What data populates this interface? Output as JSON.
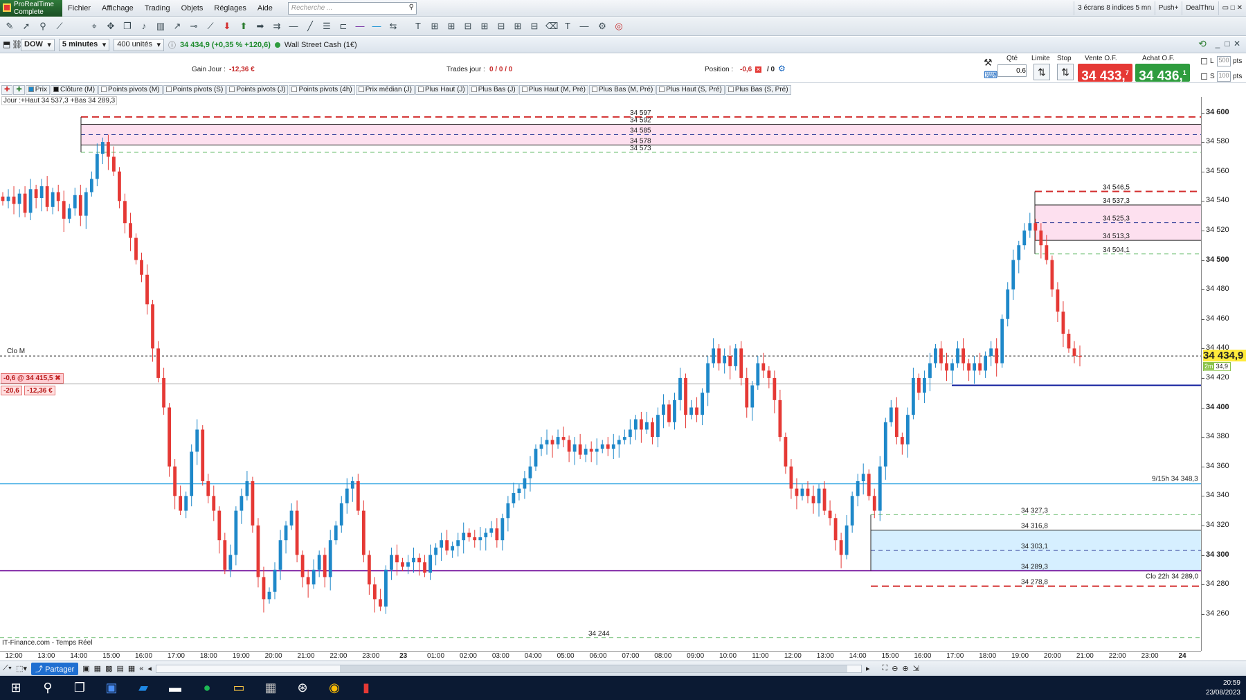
{
  "app": {
    "logo_line1": "ProRealTime",
    "logo_line2": "Complete"
  },
  "menu": [
    "Fichier",
    "Affichage",
    "Trading",
    "Objets",
    "Réglages",
    "Aide"
  ],
  "search": {
    "placeholder": "Recherche ..."
  },
  "top_right": {
    "layout": "3 écrans 8 indices 5 mn",
    "push": "Push+",
    "dealthru": "DealThru"
  },
  "instrument": {
    "symbol": "DOW",
    "period": "5 minutes",
    "units": "400 unités",
    "price": "34 434,9 (+0,35 % +120,6)",
    "name": "Wall Street Cash (1€)"
  },
  "trade": {
    "gain_label": "Gain Jour :",
    "gain_value": "-12,36 €",
    "trades_label": "Trades jour :",
    "trades_value": "0 / 0 / 0",
    "position_label": "Position :",
    "position_value": "-0,6",
    "position_extra": "/ 0",
    "qty_label": "Qté",
    "qty_value": "0.6",
    "limit_label": "Limite",
    "stop_label": "Stop",
    "sell_label": "Vente O.F.",
    "buy_label": "Achat O.F.",
    "sell_price": "34 433,",
    "sell_sup": "7",
    "buy_price": "34 436,",
    "buy_sup": "1",
    "l_label": "L",
    "s_label": "S",
    "l_pts": "500",
    "s_pts": "100",
    "pts": "pts"
  },
  "legend": [
    {
      "label": "Prix",
      "checked": true,
      "color": "#e53935"
    },
    {
      "label": "Clôture (M)",
      "checked": true,
      "color": "#111"
    },
    {
      "label": "Points pivots (M)",
      "checked": false
    },
    {
      "label": "Points pivots (S)",
      "checked": false
    },
    {
      "label": "Points pivots (J)",
      "checked": false
    },
    {
      "label": "Points pivots (4h)",
      "checked": false
    },
    {
      "label": "Prix médian (J)",
      "checked": false
    },
    {
      "label": "Plus Haut (J)",
      "checked": false
    },
    {
      "label": "Plus Bas (J)",
      "checked": false
    },
    {
      "label": "Plus Haut (M, Pré)",
      "checked": false
    },
    {
      "label": "Plus Bas (M, Pré)",
      "checked": false
    },
    {
      "label": "Plus Haut (S, Pré)",
      "checked": false
    },
    {
      "label": "Plus Bas (S, Pré)",
      "checked": false
    }
  ],
  "jour_info": "Jour :+Haut 34 537,3 +Bas 34 289,3",
  "position_box": {
    "line1": "-0,6 @ 34 415,5",
    "line2a": "-20,6",
    "line2b": "-12,36 €"
  },
  "clo_m_label": "Clo M",
  "footer_source": "IT-Finance.com - Temps Réel",
  "bottom": {
    "share": "Partager"
  },
  "clock": {
    "time": "20:59",
    "date": "23/08/2023"
  },
  "colors": {
    "up": "#1e88c9",
    "down": "#e53935",
    "pink_zone": "#fde0ef",
    "blue_zone": "#d6efff",
    "purple": "#7b1fa2",
    "cyan": "#4fb3e6",
    "navy": "#0d1a9c",
    "current_price_bg": "#ffeb3b"
  },
  "chart_data": {
    "type": "candlestick",
    "ylim": [
      34240,
      34610
    ],
    "y_ticks": [
      "34 600",
      "34 580",
      "34 560",
      "34 540",
      "34 520",
      "34 500",
      "34 480",
      "34 460",
      "34 440",
      "34 420",
      "34 400",
      "34 380",
      "34 360",
      "34 340",
      "34 320",
      "34 300",
      "34 280",
      "34 260"
    ],
    "x_ticks": [
      "12:00",
      "13:00",
      "14:00",
      "15:00",
      "16:00",
      "17:00",
      "18:00",
      "19:00",
      "20:00",
      "21:00",
      "22:00",
      "23:00",
      "23",
      "01:00",
      "02:00",
      "03:00",
      "04:00",
      "05:00",
      "06:00",
      "07:00",
      "08:00",
      "09:00",
      "10:00",
      "11:00",
      "12:00",
      "13:00",
      "14:00",
      "15:00",
      "16:00",
      "17:00",
      "18:00",
      "19:00",
      "20:00",
      "21:00",
      "22:00",
      "23:00",
      "24"
    ],
    "current_price": "34 434,9",
    "current_price_small": "34,9",
    "current_price_badge": "2m",
    "close_series": [
      34540,
      34543,
      34538,
      34545,
      34532,
      34548,
      34542,
      34550,
      34536,
      34546,
      34540,
      34528,
      34535,
      34544,
      34530,
      34546,
      34555,
      34572,
      34580,
      34570,
      34560,
      34540,
      34525,
      34515,
      34500,
      34490,
      34470,
      34440,
      34420,
      34400,
      34360,
      34340,
      34330,
      34340,
      34370,
      34385,
      34350,
      34340,
      34330,
      34310,
      34290,
      34300,
      34330,
      34340,
      34350,
      34320,
      34285,
      34270,
      34275,
      34290,
      34310,
      34320,
      34330,
      34300,
      34285,
      34280,
      34290,
      34300,
      34285,
      34310,
      34320,
      34335,
      34345,
      34350,
      34330,
      34300,
      34280,
      34270,
      34265,
      34290,
      34300,
      34295,
      34292,
      34295,
      34298,
      34295,
      34288,
      34300,
      34305,
      34310,
      34303,
      34306,
      34310,
      34315,
      34312,
      34310,
      34312,
      34315,
      34318,
      34310,
      34325,
      34335,
      34342,
      34345,
      34352,
      34360,
      34372,
      34375,
      34378,
      34375,
      34380,
      34378,
      34370,
      34375,
      34368,
      34372,
      34370,
      34372,
      34375,
      34372,
      34375,
      34378,
      34380,
      34385,
      34392,
      34385,
      34390,
      34380,
      34395,
      34402,
      34390,
      34405,
      34420,
      34395,
      34400,
      34395,
      34410,
      34430,
      34440,
      34430,
      34435,
      34428,
      34440,
      34420,
      34400,
      34415,
      34430,
      34425,
      34420,
      34405,
      34380,
      34360,
      34345,
      34340,
      34345,
      34340,
      34335,
      34345,
      34330,
      34325,
      34310,
      34300,
      34320,
      34340,
      34350,
      34355,
      34340,
      34330,
      34360,
      34390,
      34400,
      34380,
      34375,
      34395,
      34420,
      34410,
      34420,
      34430,
      34440,
      34430,
      34425,
      34430,
      34440,
      34430,
      34425,
      34430,
      34425,
      34435,
      34440,
      34430,
      34460,
      34480,
      34500,
      34510,
      34520,
      34525,
      34520,
      34510,
      34500,
      34480,
      34465,
      34450,
      34440,
      34435,
      34434.9
    ],
    "levels": [
      {
        "label": "34 597",
        "value": 34597,
        "style": "dashed",
        "color": "#d32f2f"
      },
      {
        "label": "34 592",
        "value": 34592,
        "style": "solid",
        "color": "#222"
      },
      {
        "label": "34 585",
        "value": 34585,
        "style": "dashed",
        "color": "#283593"
      },
      {
        "label": "34 578",
        "value": 34578,
        "style": "solid",
        "color": "#222"
      },
      {
        "label": "34 573",
        "value": 34573,
        "style": "dashed",
        "color": "#66bb6a"
      },
      {
        "label": "34 546,5",
        "value": 34546.5,
        "style": "dashed",
        "color": "#d32f2f"
      },
      {
        "label": "34 537,3",
        "value": 34537.3,
        "style": "solid",
        "color": "#222"
      },
      {
        "label": "34 525,3",
        "value": 34525.3,
        "style": "dashed",
        "color": "#283593"
      },
      {
        "label": "34 513,3",
        "value": 34513.3,
        "style": "solid",
        "color": "#222"
      },
      {
        "label": "34 504,1",
        "value": 34504.1,
        "style": "dashed",
        "color": "#66bb6a"
      },
      {
        "label": "34 327,3",
        "value": 34327.3,
        "style": "dashed",
        "color": "#66bb6a"
      },
      {
        "label": "34 316,8",
        "value": 34316.8,
        "style": "solid",
        "color": "#222"
      },
      {
        "label": "34 303,1",
        "value": 34303.1,
        "style": "dashed",
        "color": "#283593"
      },
      {
        "label": "34 289,3",
        "value": 34289.3,
        "style": "solid",
        "color": "#7b1fa2"
      },
      {
        "label": "34 278,8",
        "value": 34278.8,
        "style": "dashed",
        "color": "#d32f2f"
      },
      {
        "label": "34 244",
        "value": 34244,
        "style": "dashed",
        "color": "#66bb6a"
      }
    ],
    "weekly_label": "9/15h 34 348,3",
    "weekly_value": 34348.3,
    "clo22_label": "Clo 22h 34 289,0",
    "clo_m_value": 34434.9,
    "navy_value": 34415,
    "short_value": 34415.5
  }
}
